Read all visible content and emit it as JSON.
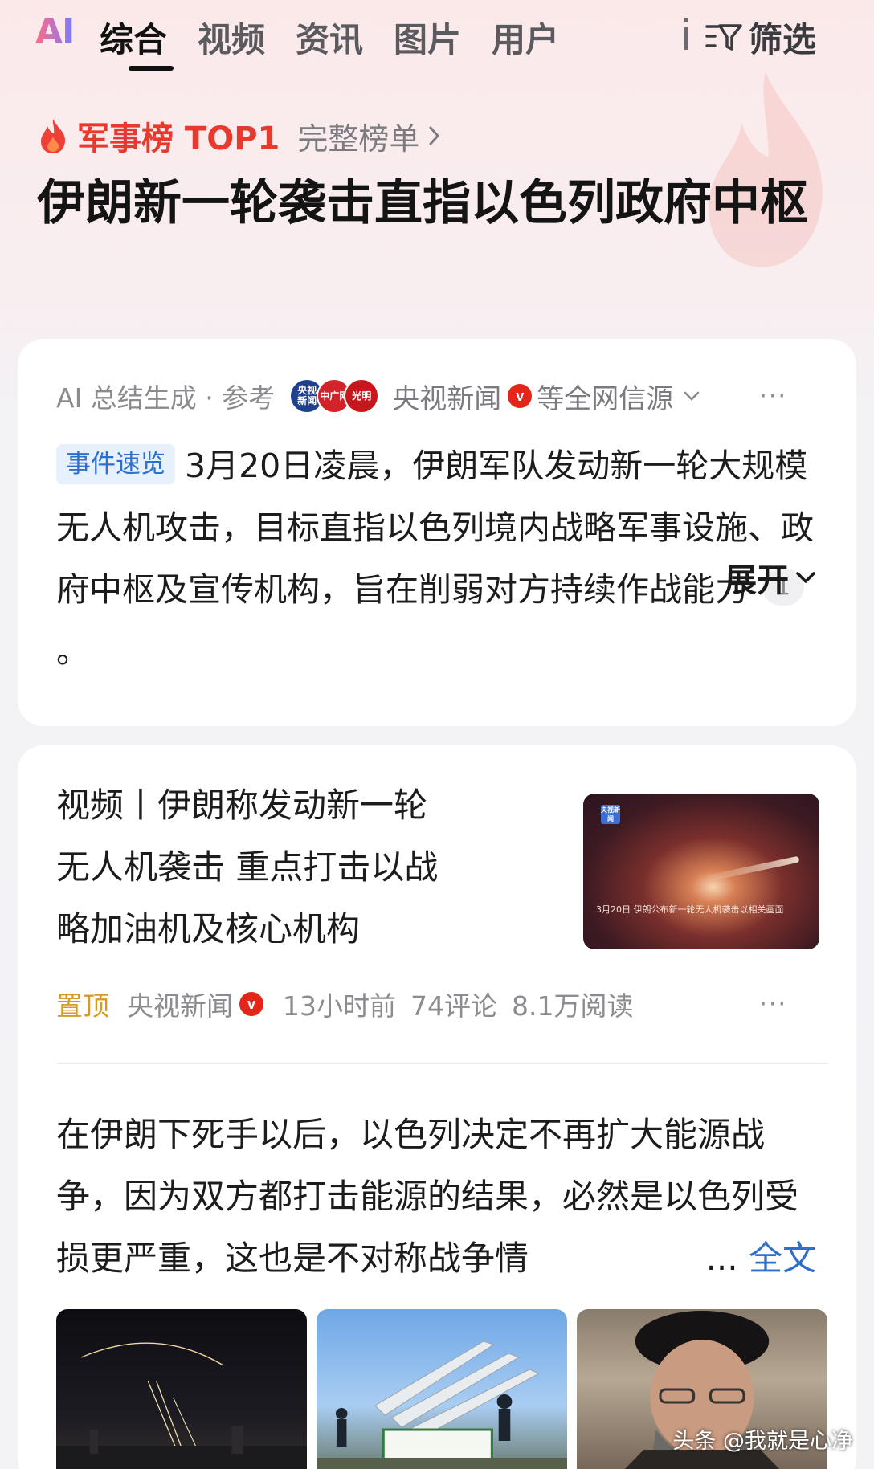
{
  "tabs": {
    "ai": "AI",
    "items": [
      "综合",
      "视频",
      "资讯",
      "图片",
      "用户"
    ],
    "active_index": 0,
    "filter_label": "筛选"
  },
  "rank": {
    "label": "军事榜 TOP1",
    "link": "完整榜单"
  },
  "headline": "伊朗新一轮袭击直指以色列政府中枢",
  "ai_card": {
    "prefix": "AI 总结生成 · 参考",
    "source_logos": [
      "央视新闻",
      "中广网",
      "光明日报"
    ],
    "source_name": "央视新闻",
    "verified": "v",
    "source_suffix": "等全网信源",
    "more": "···",
    "event_tag": "事件速览",
    "summary": "3月20日凌晨，伊朗军队发动新一轮大规模无人机攻击，目标直指以色列境内战略军事设施、政府中枢及宣传机构，旨在削弱对方持续作战能力",
    "citation": "1",
    "summary_end": "。",
    "expand_label": "展开"
  },
  "news_card": {
    "title": "视频丨伊朗称发动新一轮无人机袭击 重点打击以战略加油机及核心机构",
    "thumb_logo": "央视新闻",
    "thumb_caption": "3月20日 伊朗公布新一轮无人机袭击以相关画面",
    "pinned": "置顶",
    "source": "央视新闻",
    "verified": "v",
    "time": "13小时前",
    "comments": "74评论",
    "reads": "8.1万阅读",
    "more": "···"
  },
  "article": {
    "text": "在伊朗下死手以后，以色列决定不再扩大能源战争，因为双方都打击能源的结果，必然是以色列受损更严重，这也是不对称战争情",
    "ellipsis": "...",
    "fulltext_label": "全文"
  },
  "watermark": "头条 @我就是心净",
  "colors": {
    "accent_red": "#e8392f",
    "link_blue": "#2f6fcc",
    "pin_orange": "#d99a23"
  }
}
